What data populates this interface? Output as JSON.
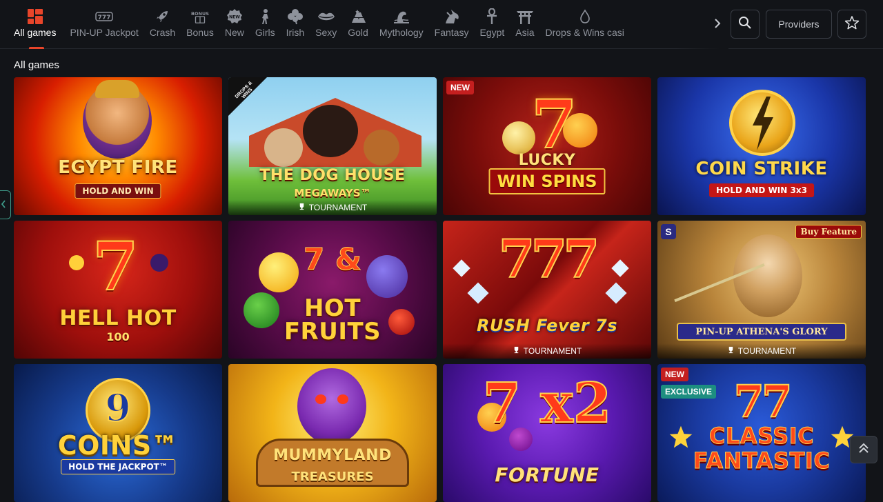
{
  "categories": [
    {
      "label": "All games",
      "icon": "grid-icon",
      "active": true
    },
    {
      "label": "PIN-UP Jackpot",
      "icon": "jackpot-777-icon"
    },
    {
      "label": "Crash",
      "icon": "rocket-icon"
    },
    {
      "label": "Bonus",
      "icon": "bonus-icon",
      "icon_text": "BONUS"
    },
    {
      "label": "New",
      "icon": "new-badge-icon",
      "icon_text": "NEW"
    },
    {
      "label": "Girls",
      "icon": "girl-icon"
    },
    {
      "label": "Irish",
      "icon": "clover-icon"
    },
    {
      "label": "Sexy",
      "icon": "lips-icon"
    },
    {
      "label": "Gold",
      "icon": "gold-bars-icon"
    },
    {
      "label": "Mythology",
      "icon": "mythology-icon"
    },
    {
      "label": "Fantasy",
      "icon": "dragon-icon"
    },
    {
      "label": "Egypt",
      "icon": "ankh-icon"
    },
    {
      "label": "Asia",
      "icon": "torii-gate-icon"
    },
    {
      "label": "Drops & Wins casi",
      "icon": "drops-wins-icon"
    }
  ],
  "header": {
    "providers_label": "Providers"
  },
  "section": {
    "title": "All games"
  },
  "games": [
    {
      "title": "EGYPT FIRE",
      "subtitle": "HOLD AND WIN"
    },
    {
      "title": "THE DOG HOUSE",
      "subtitle": "MEGAWAYS™",
      "tournament": "TOURNAMENT",
      "corner": "DROPS & WINS"
    },
    {
      "title": "LUCKY",
      "subtitle": "WIN SPINS",
      "badge_new": "NEW"
    },
    {
      "title": "COIN STRIKE",
      "subtitle": "HOLD AND WIN 3x3"
    },
    {
      "title": "HELL HOT",
      "subtitle": "100"
    },
    {
      "title": "HOT FRUITS",
      "subtitle": "7 &"
    },
    {
      "title": "RUSH Fever 7s",
      "subtitle": "777",
      "tournament": "TOURNAMENT"
    },
    {
      "title": "PIN-UP ATHENA'S GLORY",
      "subtitle": "Buy Feature",
      "tournament": "TOURNAMENT",
      "provider_mark": "S"
    },
    {
      "title": "COINS™",
      "subtitle": "HOLD THE JACKPOT™",
      "top_text": "9"
    },
    {
      "title": "MUMMYLAND",
      "subtitle": "TREASURES"
    },
    {
      "title": "FORTUNE",
      "subtitle": "7 x2"
    },
    {
      "title": "CLASSIC FANTASTIC",
      "subtitle": "77",
      "badge_new": "NEW",
      "badge_exclusive": "EXCLUSIVE"
    }
  ],
  "colors": {
    "accent": "#e8452a",
    "background": "#121418",
    "badge_new": "#c41f1f",
    "badge_exclusive": "#1d8e80"
  }
}
